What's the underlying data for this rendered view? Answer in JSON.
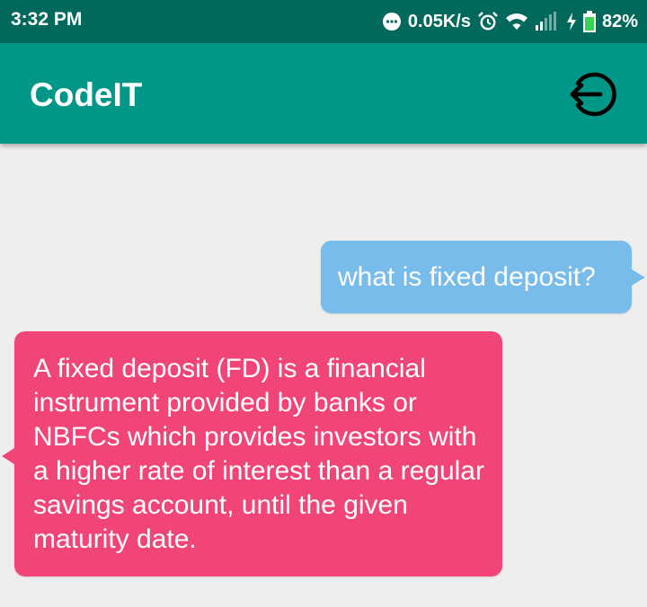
{
  "status_bar": {
    "time": "3:32 PM",
    "net_speed": "0.05K/s",
    "battery": "82%",
    "icons": [
      "more-dots-icon",
      "alarm-icon",
      "wifi-icon",
      "signal-icon",
      "charging-icon",
      "battery-icon"
    ]
  },
  "app_bar": {
    "title": "CodeIT",
    "action_icon": "logout-icon",
    "color": "#009688"
  },
  "chat": {
    "messages": [
      {
        "sender": "user",
        "text": "what is fixed deposit?",
        "color": "#78bcec"
      },
      {
        "sender": "bot",
        "text": "A fixed deposit (FD) is a financial instrument provided by banks or NBFCs which provides investors with a higher rate of interest than a regular savings account, until the given maturity date.",
        "color": "#f24577"
      }
    ]
  }
}
